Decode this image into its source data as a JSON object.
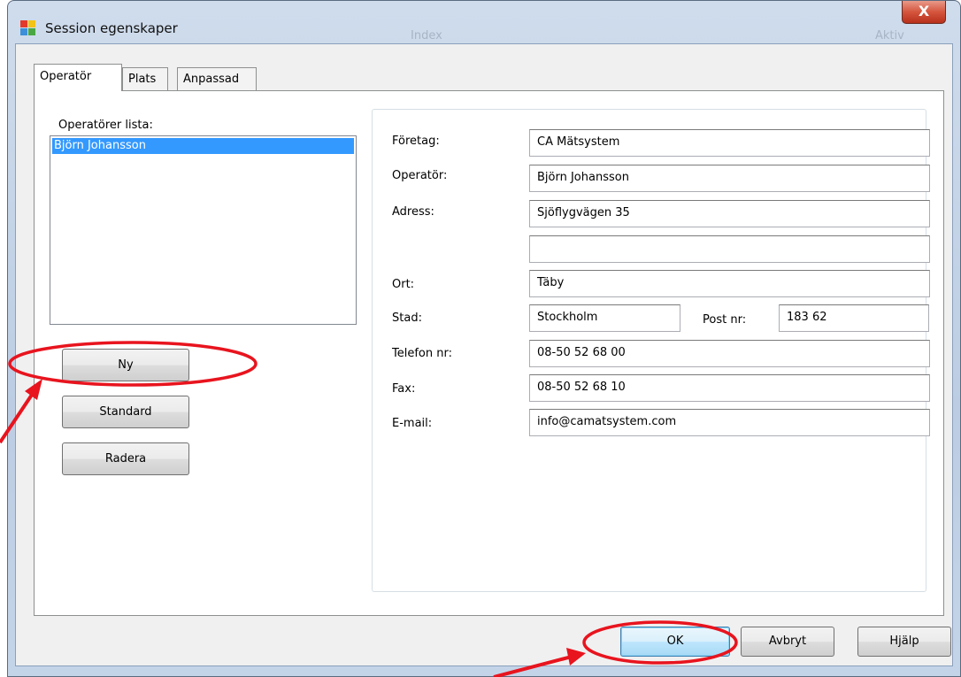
{
  "window": {
    "title": "Session egenskaper",
    "ghost_text_1": "Index",
    "ghost_text_2": "Aktiv",
    "close_label": "X"
  },
  "tabs": [
    {
      "label": "Operatör",
      "active": true
    },
    {
      "label": "Plats",
      "active": false
    },
    {
      "label": "Anpassad",
      "active": false
    }
  ],
  "operator_list": {
    "label": "Operatörer lista:",
    "items": [
      {
        "name": "Björn Johansson",
        "selected": true
      }
    ]
  },
  "list_buttons": {
    "new": "Ny",
    "standard": "Standard",
    "delete": "Radera"
  },
  "form": {
    "company": {
      "label": "Företag:",
      "value": "CA Mätsystem"
    },
    "operator": {
      "label": "Operatör:",
      "value": "Björn Johansson"
    },
    "address": {
      "label": "Adress:",
      "value": "Sjöflygvägen 35"
    },
    "address2": {
      "value": ""
    },
    "locality": {
      "label": "Ort:",
      "value": "Täby"
    },
    "city": {
      "label": "Stad:",
      "value": "Stockholm"
    },
    "postcode": {
      "label": "Post nr:",
      "value": "183 62"
    },
    "phone": {
      "label": "Telefon nr:",
      "value": "08-50 52 68 00"
    },
    "fax": {
      "label": "Fax:",
      "value": "08-50 52 68 10"
    },
    "email": {
      "label": "E-mail:",
      "value": "info@camatsystem.com"
    }
  },
  "dialog_buttons": {
    "ok": "OK",
    "cancel": "Avbryt",
    "help": "Hjälp"
  },
  "colors": {
    "selection": "#3399ff",
    "annotation": "#e8141e"
  }
}
